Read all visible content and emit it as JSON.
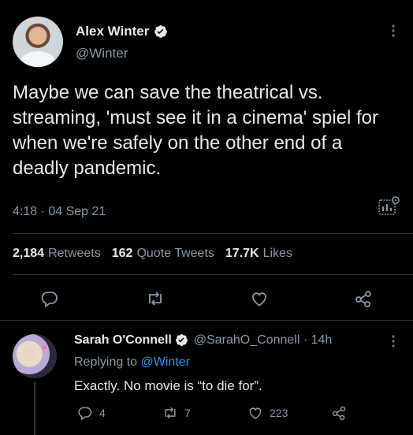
{
  "tweet": {
    "author_name": "Alex Winter",
    "handle": "@Winter",
    "text": "Maybe we can save the theatrical vs. streaming, 'must see it in a cinema' spiel for when we're safely on the other end of a deadly pandemic.",
    "timestamp": "4:18 · 04 Sep 21",
    "stats": {
      "retweets_count": "2,184",
      "retweets_label": "Retweets",
      "quotes_count": "162",
      "quotes_label": "Quote Tweets",
      "likes_count": "17.7K",
      "likes_label": "Likes"
    }
  },
  "reply": {
    "author_name": "Sarah O'Connell",
    "handle_time": "@SarahO_Connell · 14h",
    "replying_prefix": "Replying to",
    "replying_to": "@Winter",
    "text": "Exactly. No movie is “to die for”.",
    "reply_count": "4",
    "retweet_count": "7",
    "like_count": "223"
  },
  "colors": {
    "background": "#000000",
    "text_primary": "#e7e9ea",
    "text_secondary": "#8b98a5",
    "accent": "#1d9bf0",
    "divider": "#2f3336"
  },
  "icons": [
    "verified-badge-icon",
    "more-icon",
    "analytics-icon",
    "reply-icon",
    "retweet-icon",
    "like-icon",
    "share-icon"
  ]
}
